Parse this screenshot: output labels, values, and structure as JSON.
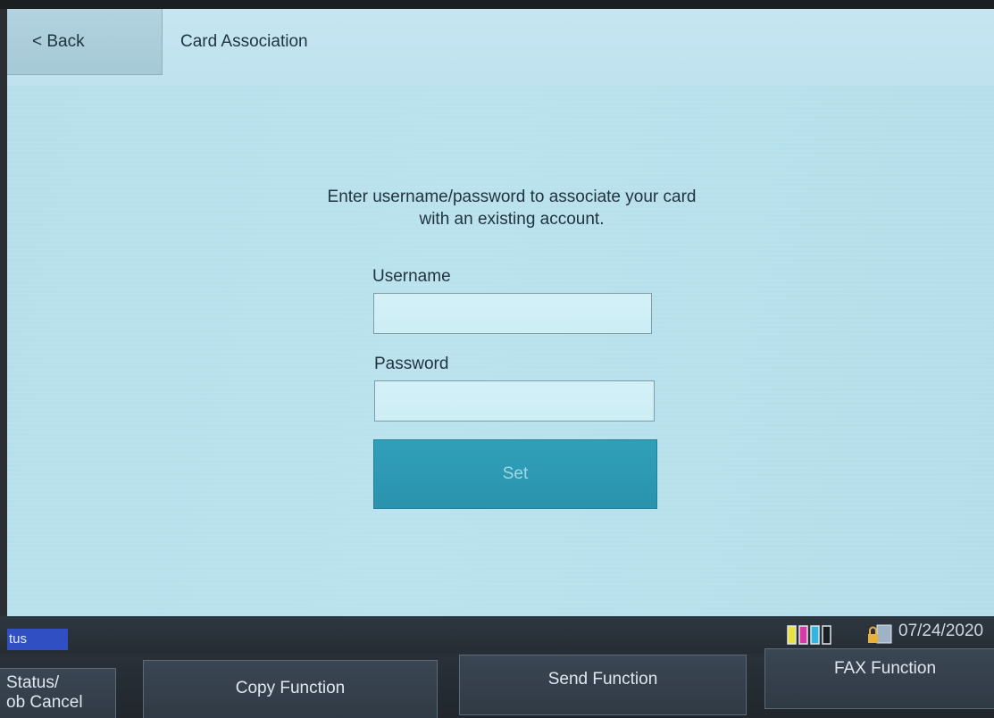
{
  "header": {
    "back_label": "< Back",
    "title": "Card Association"
  },
  "main": {
    "instruction_line1": "Enter username/password to associate your card",
    "instruction_line2": "with an existing account.",
    "username_label": "Username",
    "username_value": "",
    "password_label": "Password",
    "password_value": "",
    "set_label": "Set"
  },
  "status_bar": {
    "status_tab": "tus",
    "date": "07/24/2020",
    "toner_icon": "toner-level-icon",
    "lock_icon": "security-lock-icon"
  },
  "function_bar": {
    "status_button": "Status/\nob Cancel",
    "copy_button": "Copy Function",
    "send_button": "Send Function",
    "fax_button": "FAX Function"
  },
  "colors": {
    "header_bg": "#c6e6f1",
    "content_bg": "#b6dfea",
    "accent_button": "#2a93ad",
    "status_tab": "#2f4fc2",
    "function_bar": "#303a45"
  }
}
